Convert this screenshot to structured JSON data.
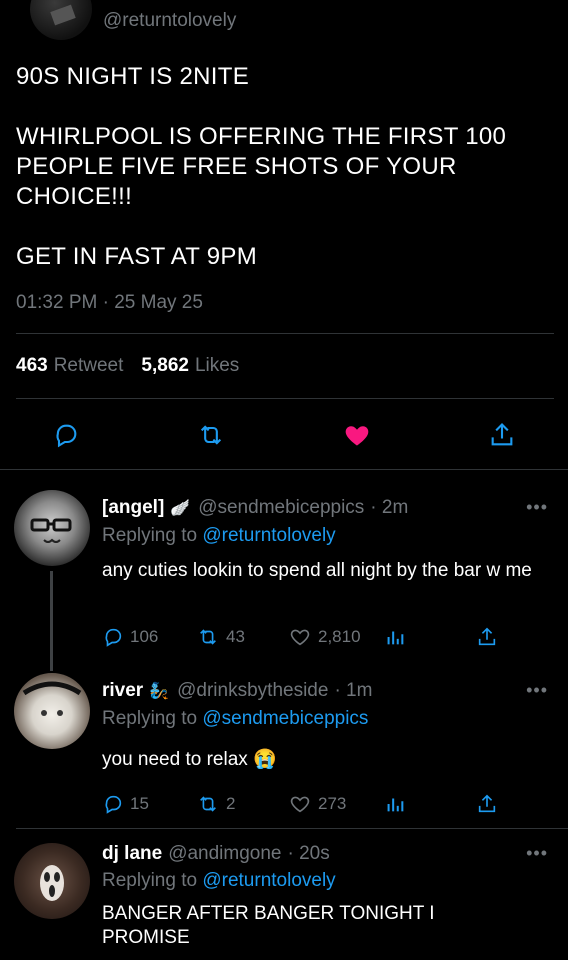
{
  "main_tweet": {
    "handle": "@returntolovely",
    "text_paragraphs": [
      "90S NIGHT IS 2NITE",
      "WHIRLPOOL IS OFFERING THE FIRST 100\nPEOPLE FIVE FREE SHOTS OF YOUR\nCHOICE!!!",
      "GET IN FAST AT 9PM"
    ],
    "time": "01:32 PM",
    "dot": "·",
    "date": "25 May 25",
    "retweet_count": "463",
    "retweet_label": "Retweet",
    "like_count": "5,862",
    "like_label": "Likes",
    "liked": true,
    "like_color": "#f91880"
  },
  "replies": [
    {
      "name": "[angel]",
      "name_emoji": "🪽",
      "handle": "@sendmebiceppics",
      "time": "· 2m",
      "replying_prefix": "Replying to",
      "replying_to": "@returntolovely",
      "text": "any cuties lookin to spend all night by the bar w me",
      "replies": "106",
      "retweets": "43",
      "likes": "2,810",
      "more": "•••"
    },
    {
      "name": "river",
      "name_emoji": "🧞",
      "handle": "@drinksbytheside",
      "time": "· 1m",
      "replying_prefix": "Replying to",
      "replying_to": "@sendmebiceppics",
      "text": "you need to relax 😭",
      "replies": "15",
      "retweets": "2",
      "likes": "273",
      "more": "•••"
    },
    {
      "name": "dj lane",
      "handle": "@andimgone",
      "time": "· 20s",
      "replying_prefix": "Replying to",
      "replying_to": "@returntolovely",
      "text": "BANGER AFTER BANGER TONIGHT I PROMISE",
      "more": "•••"
    }
  ],
  "colors": {
    "background": "#000000",
    "text": "#ffffff",
    "muted": "#71767b",
    "link": "#1d9bf0",
    "divider": "#2f3336"
  }
}
